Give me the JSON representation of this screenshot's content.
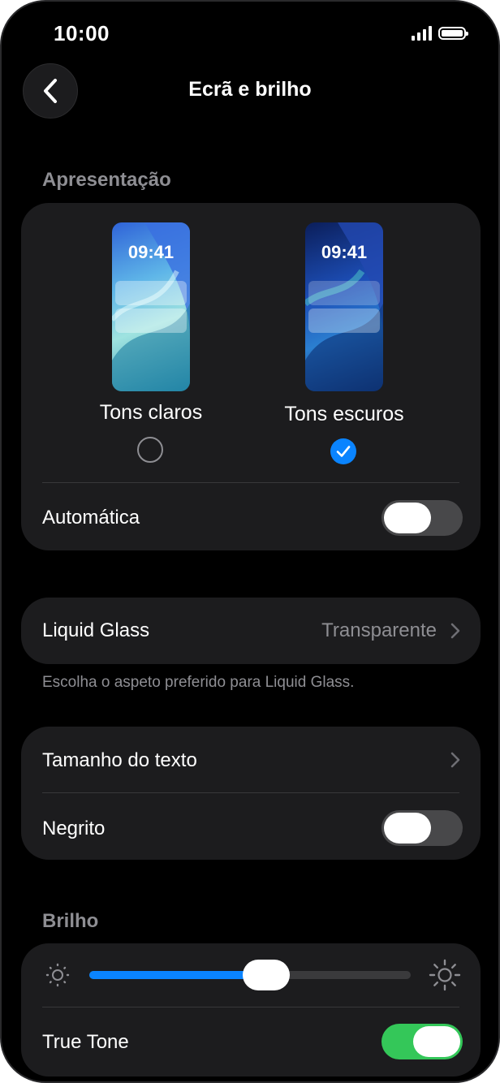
{
  "status": {
    "time": "10:00"
  },
  "nav": {
    "title": "Ecrã e brilho"
  },
  "appearance": {
    "header": "Apresentação",
    "light": {
      "label": "Tons claros",
      "clock": "09:41",
      "selected": false
    },
    "dark": {
      "label": "Tons escuros",
      "clock": "09:41",
      "selected": true
    },
    "automatic": {
      "label": "Automática",
      "on": false
    }
  },
  "liquid_glass": {
    "label": "Liquid Glass",
    "value": "Transparente",
    "note": "Escolha o aspeto preferido para Liquid Glass."
  },
  "text": {
    "size_label": "Tamanho do texto",
    "bold_label": "Negrito",
    "bold_on": false
  },
  "brightness": {
    "header": "Brilho",
    "level": 0.55,
    "true_tone_label": "True Tone",
    "true_tone_on": true
  },
  "colors": {
    "accent": "#0a84ff",
    "toggle_on": "#34c759",
    "toggle_off": "#48484a",
    "card": "#1c1c1e",
    "secondary_text": "#8e8e93"
  }
}
